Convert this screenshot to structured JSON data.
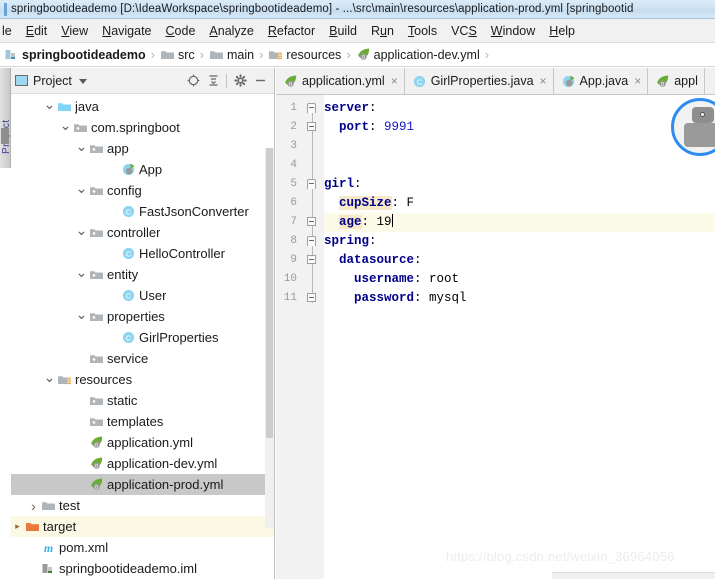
{
  "window": {
    "title": "springbootideademo [D:\\IdeaWorkspace\\springbootideademo] - ...\\src\\main\\resources\\application-prod.yml [springbootid"
  },
  "menubar": {
    "items": [
      {
        "label": "le",
        "mnemonic": ""
      },
      {
        "label": "Edit",
        "mnemonic": "E"
      },
      {
        "label": "View",
        "mnemonic": "V"
      },
      {
        "label": "Navigate",
        "mnemonic": "N"
      },
      {
        "label": "Code",
        "mnemonic": "C"
      },
      {
        "label": "Analyze",
        "mnemonic": "A"
      },
      {
        "label": "Refactor",
        "mnemonic": "R"
      },
      {
        "label": "Build",
        "mnemonic": "B"
      },
      {
        "label": "Run",
        "mnemonic": "u"
      },
      {
        "label": "Tools",
        "mnemonic": "T"
      },
      {
        "label": "VCS",
        "mnemonic": "S"
      },
      {
        "label": "Window",
        "mnemonic": "W"
      },
      {
        "label": "Help",
        "mnemonic": "H"
      }
    ]
  },
  "breadcrumb": {
    "items": [
      {
        "label": "springbootideademo",
        "icon": "module-icon"
      },
      {
        "label": "src",
        "icon": "folder-icon"
      },
      {
        "label": "main",
        "icon": "folder-icon"
      },
      {
        "label": "resources",
        "icon": "resources-folder-icon"
      },
      {
        "label": "application-dev.yml",
        "icon": "yml-file-icon"
      }
    ],
    "separator": "›"
  },
  "project_panel": {
    "title": "Project",
    "toolbar": [
      {
        "name": "locate-icon",
        "glyph": "⊕"
      },
      {
        "name": "collapse-all-icon",
        "glyph": "≡"
      },
      {
        "name": "gear-icon",
        "glyph": "⚙"
      },
      {
        "name": "hide-icon",
        "glyph": "—"
      }
    ],
    "tree": [
      {
        "label": "java",
        "indent": 2,
        "arrow": "down",
        "icon": "source-folder-icon",
        "state": "normal"
      },
      {
        "label": "com.springboot",
        "indent": 3,
        "arrow": "down",
        "icon": "package-icon",
        "state": "normal"
      },
      {
        "label": "app",
        "indent": 4,
        "arrow": "down",
        "icon": "package-icon",
        "state": "normal"
      },
      {
        "label": "App",
        "indent": 6,
        "arrow": "none",
        "icon": "spring-class-icon",
        "state": "normal"
      },
      {
        "label": "config",
        "indent": 4,
        "arrow": "down",
        "icon": "package-icon",
        "state": "normal"
      },
      {
        "label": "FastJsonConverter",
        "indent": 6,
        "arrow": "none",
        "icon": "java-class-icon",
        "state": "normal"
      },
      {
        "label": "controller",
        "indent": 4,
        "arrow": "down",
        "icon": "package-icon",
        "state": "normal"
      },
      {
        "label": "HelloController",
        "indent": 6,
        "arrow": "none",
        "icon": "java-class-icon",
        "state": "normal"
      },
      {
        "label": "entity",
        "indent": 4,
        "arrow": "down",
        "icon": "package-icon",
        "state": "normal"
      },
      {
        "label": "User",
        "indent": 6,
        "arrow": "none",
        "icon": "java-class-icon",
        "state": "normal"
      },
      {
        "label": "properties",
        "indent": 4,
        "arrow": "down",
        "icon": "package-icon",
        "state": "normal"
      },
      {
        "label": "GirlProperties",
        "indent": 6,
        "arrow": "none",
        "icon": "java-class-icon",
        "state": "normal"
      },
      {
        "label": "service",
        "indent": 4,
        "arrow": "none",
        "icon": "package-icon",
        "state": "normal"
      },
      {
        "label": "resources",
        "indent": 2,
        "arrow": "down",
        "icon": "resources-folder-icon",
        "state": "normal"
      },
      {
        "label": "static",
        "indent": 4,
        "arrow": "none",
        "icon": "package-icon",
        "state": "normal"
      },
      {
        "label": "templates",
        "indent": 4,
        "arrow": "none",
        "icon": "package-icon",
        "state": "normal"
      },
      {
        "label": "application.yml",
        "indent": 4,
        "arrow": "none",
        "icon": "yml-file-icon",
        "state": "normal"
      },
      {
        "label": "application-dev.yml",
        "indent": 4,
        "arrow": "none",
        "icon": "yml-file-icon",
        "state": "normal"
      },
      {
        "label": "application-prod.yml",
        "indent": 4,
        "arrow": "none",
        "icon": "yml-file-icon",
        "state": "selected"
      },
      {
        "label": "test",
        "indent": 1,
        "arrow": "right",
        "icon": "test-folder-icon",
        "state": "normal"
      },
      {
        "label": "target",
        "indent": 0,
        "arrow": "right-small",
        "icon": "target-folder-icon",
        "state": "highlight"
      },
      {
        "label": "pom.xml",
        "indent": 1,
        "arrow": "none",
        "icon": "maven-icon",
        "state": "normal"
      },
      {
        "label": "springbootideademo.iml",
        "indent": 1,
        "arrow": "none",
        "icon": "iml-icon",
        "state": "normal"
      }
    ]
  },
  "editor": {
    "tabs": [
      {
        "label": "application.yml",
        "icon": "yml-file-icon",
        "active": false,
        "close": "×"
      },
      {
        "label": "GirlProperties.java",
        "icon": "java-class-icon",
        "active": false,
        "close": "×"
      },
      {
        "label": "App.java",
        "icon": "spring-class-icon",
        "active": false,
        "close": "×"
      },
      {
        "label": "appl",
        "icon": "yml-file-icon",
        "active": true,
        "close": ""
      }
    ],
    "line_numbers": [
      "1",
      "2",
      "3",
      "4",
      "5",
      "6",
      "7",
      "8",
      "9",
      "10",
      "11"
    ],
    "lines": [
      {
        "num": 1,
        "indent": 0,
        "key": "server",
        "sep": ":",
        "value": "",
        "value_type": "none",
        "key_highlight": false,
        "current": false
      },
      {
        "num": 2,
        "indent": 1,
        "key": "port",
        "sep": ":",
        "value": "9991",
        "value_type": "number",
        "key_highlight": false,
        "current": false
      },
      {
        "num": 3,
        "indent": 0,
        "key": "",
        "sep": "",
        "value": "",
        "value_type": "none",
        "key_highlight": false,
        "current": false
      },
      {
        "num": 4,
        "indent": 0,
        "key": "",
        "sep": "",
        "value": "",
        "value_type": "none",
        "key_highlight": false,
        "current": false
      },
      {
        "num": 5,
        "indent": 0,
        "key": "girl",
        "sep": ":",
        "value": "",
        "value_type": "none",
        "key_highlight": false,
        "current": false
      },
      {
        "num": 6,
        "indent": 1,
        "key": "cupSize",
        "sep": ":",
        "value": "F",
        "value_type": "text",
        "key_highlight": true,
        "current": false
      },
      {
        "num": 7,
        "indent": 1,
        "key": "age",
        "sep": ":",
        "value": "19",
        "value_type": "text",
        "key_highlight": true,
        "current": true
      },
      {
        "num": 8,
        "indent": 0,
        "key": "spring",
        "sep": ":",
        "value": "",
        "value_type": "none",
        "key_highlight": false,
        "current": false
      },
      {
        "num": 9,
        "indent": 1,
        "key": "datasource",
        "sep": ":",
        "value": "",
        "value_type": "none",
        "key_highlight": false,
        "current": false
      },
      {
        "num": 10,
        "indent": 2,
        "key": "username",
        "sep": ":",
        "value": "root",
        "value_type": "text",
        "key_highlight": false,
        "current": false
      },
      {
        "num": 11,
        "indent": 2,
        "key": "password",
        "sep": ":",
        "value": "mysql",
        "value_type": "text",
        "key_highlight": false,
        "current": false
      }
    ],
    "caret_line": 7
  },
  "watermark": {
    "text": "https://blog.csdn.net/weixin_36964056"
  },
  "colors": {
    "accent_blue": "#2d8cf0",
    "key_blue": "#00008b",
    "number_blue": "#1616c8",
    "selection_gray": "#c8c8c8",
    "current_line": "#fcfae8",
    "highlight_tan": "#f5e9c8",
    "target_folder": "#e8783c"
  }
}
